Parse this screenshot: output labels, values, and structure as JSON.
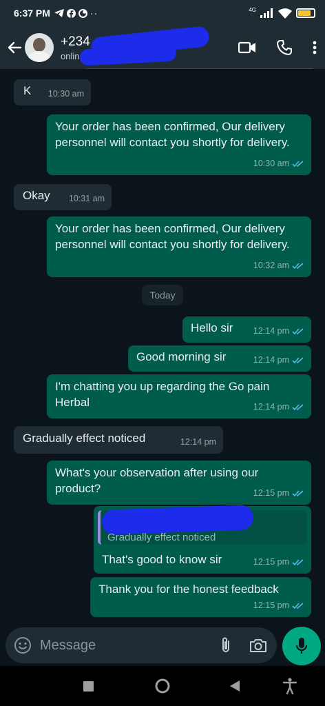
{
  "status_bar": {
    "time": "6:37 PM",
    "signal_label": "4G"
  },
  "header": {
    "contact_name": "+234",
    "contact_status": "onlin"
  },
  "colors": {
    "outgoing": "#005c4b",
    "incoming": "#202c33",
    "accent": "#00a884",
    "ticks": "#53bdeb"
  },
  "messages": [
    {
      "dir": "in",
      "text": "K",
      "time": "10:30 am"
    },
    {
      "dir": "out",
      "text": "Your order has been confirmed, Our delivery personnel will contact you shortly for delivery.",
      "time": "10:30 am"
    },
    {
      "dir": "in",
      "text": "Okay",
      "time": "10:31 am"
    },
    {
      "dir": "out",
      "text": "Your order has been confirmed, Our delivery personnel will contact you shortly for delivery.",
      "time": "10:32 am"
    },
    {
      "dir": "out",
      "text": "Hello sir",
      "time": "12:14 pm"
    },
    {
      "dir": "out",
      "text": "Good morning sir",
      "time": "12:14 pm"
    },
    {
      "dir": "out",
      "text": "I'm chatting you up regarding the Go pain Herbal",
      "time": "12:14 pm"
    },
    {
      "dir": "in",
      "text": "Gradually effect noticed",
      "time": "12:14 pm"
    },
    {
      "dir": "out",
      "text": "What's your observation after using our product?",
      "time": "12:15 pm"
    },
    {
      "dir": "out",
      "text": "That's good to know sir",
      "time": "12:15 pm",
      "quoted_text": "Gradually effect noticed"
    },
    {
      "dir": "out",
      "text": "Thank you for the honest feedback",
      "time": "12:15 pm"
    }
  ],
  "date_separator": "Today",
  "composer": {
    "placeholder": "Message"
  }
}
